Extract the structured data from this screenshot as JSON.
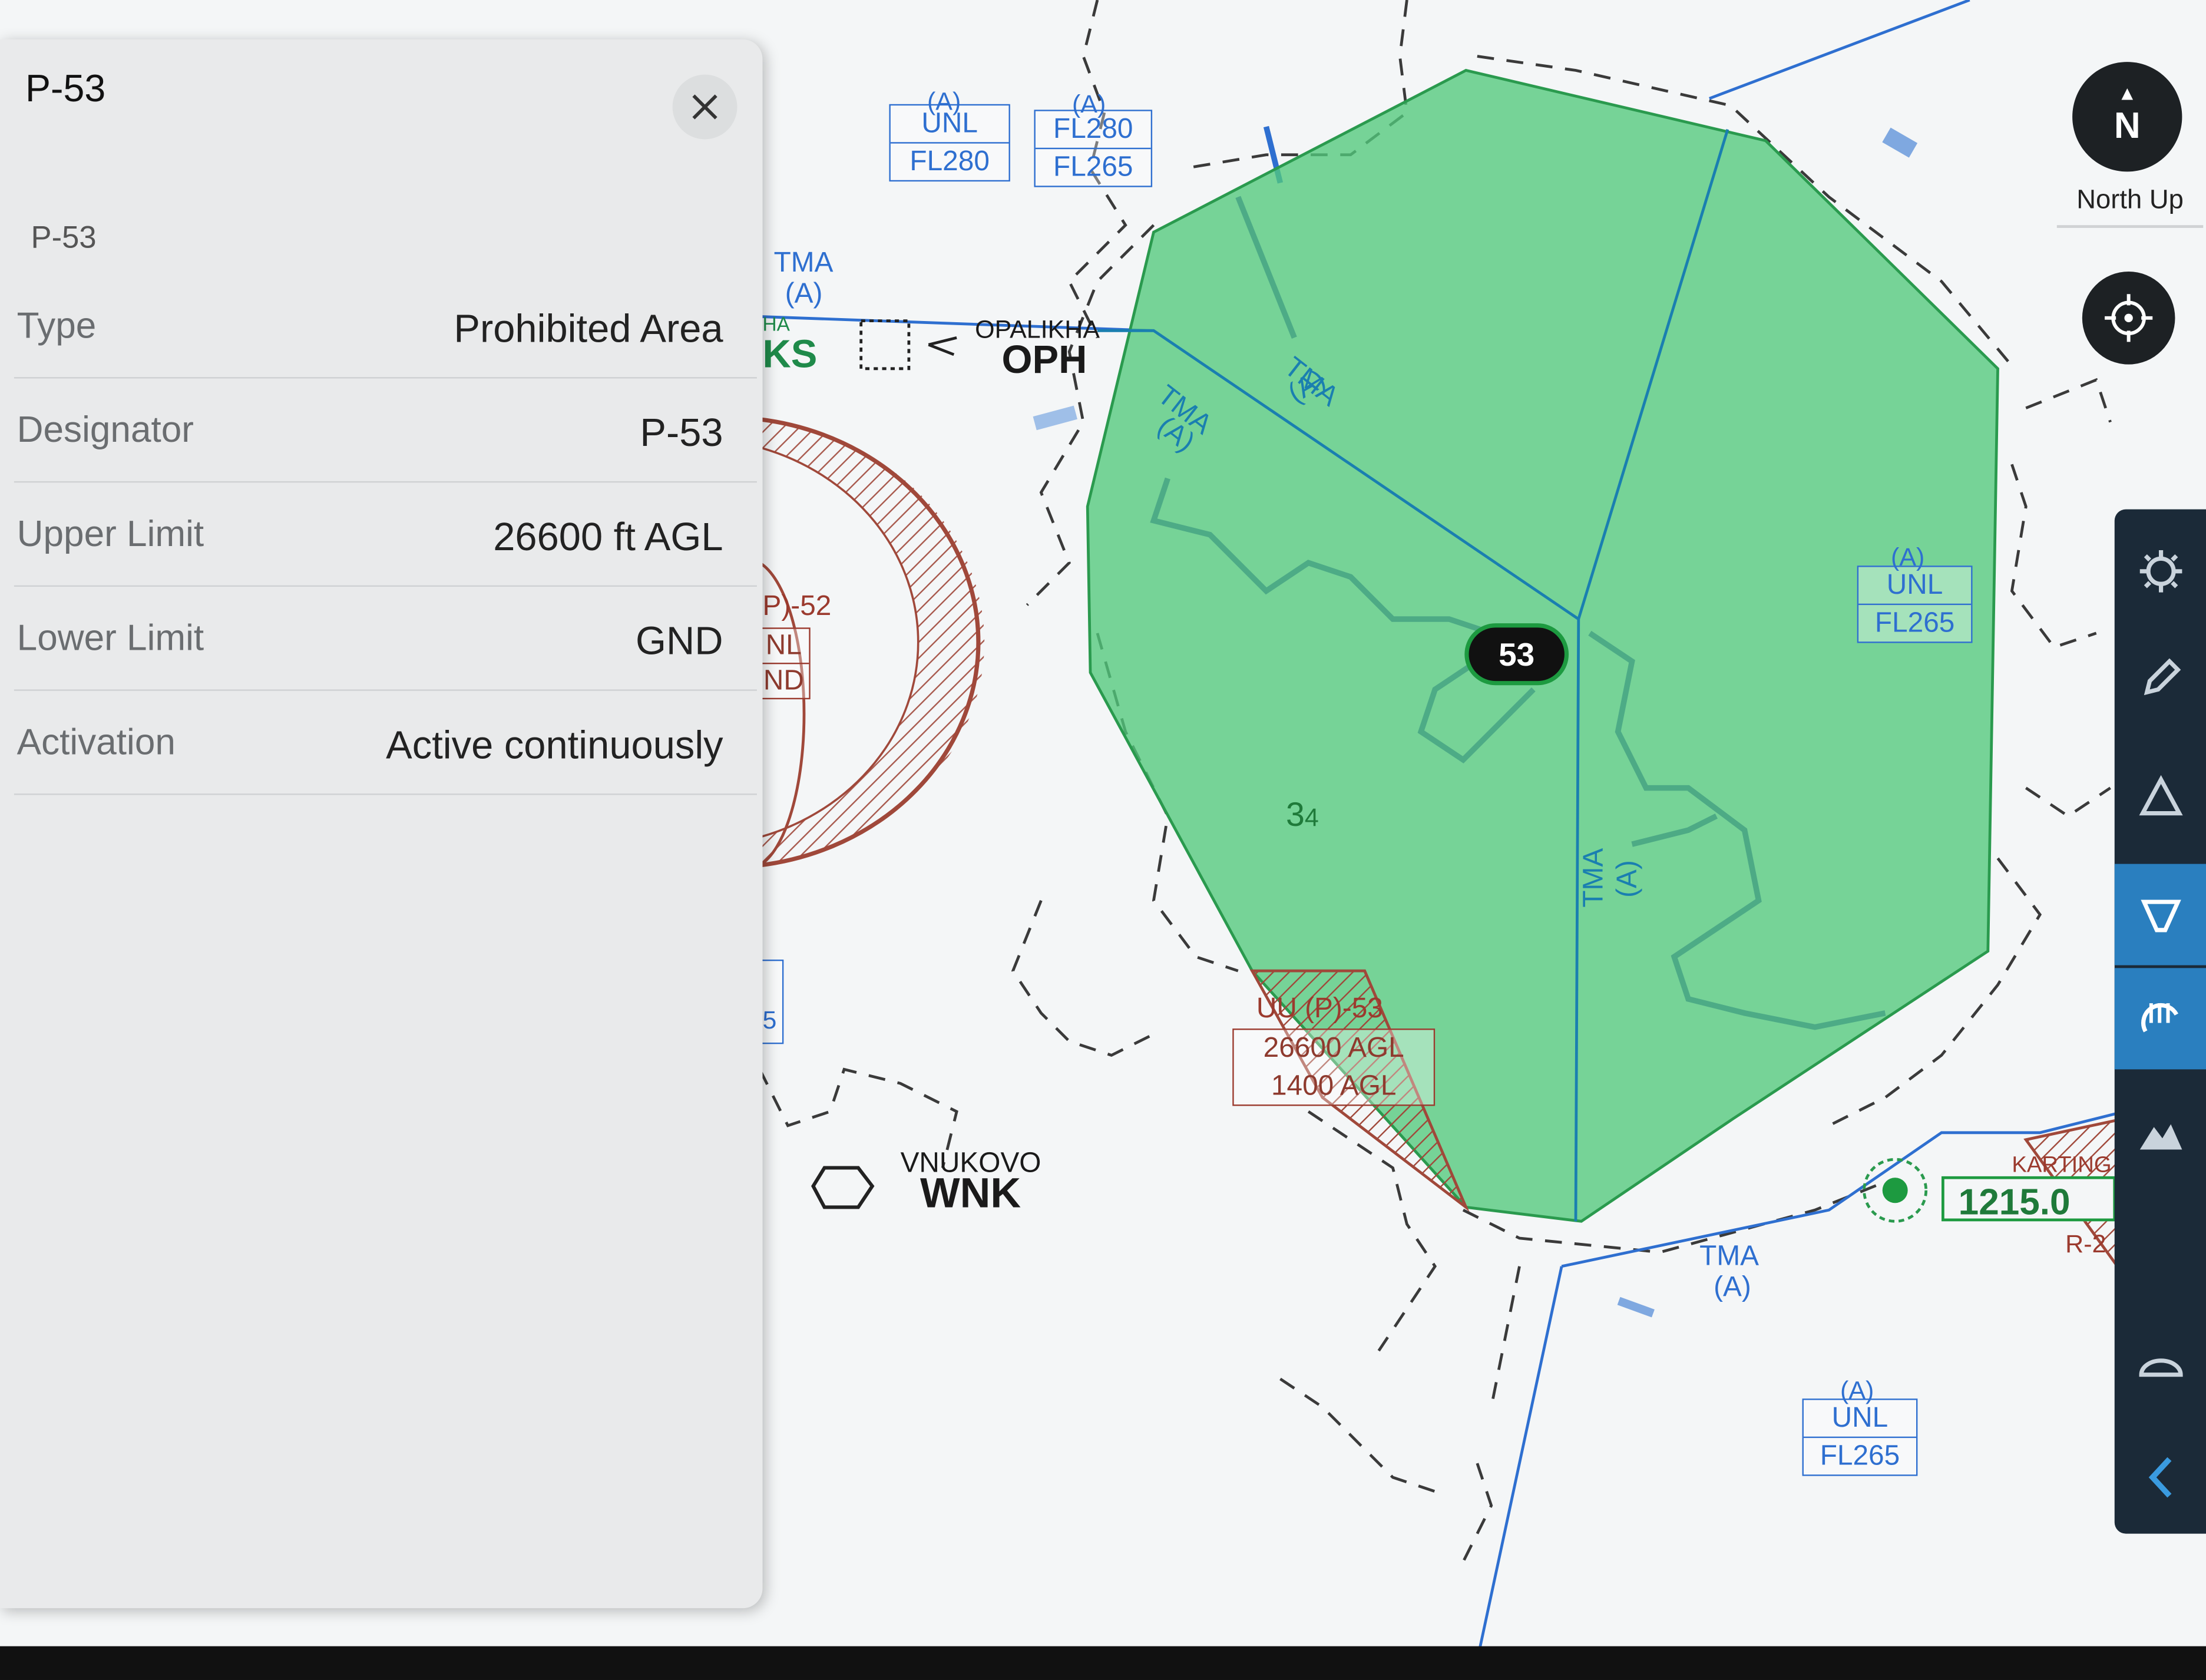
{
  "panel": {
    "title": "P-53",
    "subtitle": "P-53",
    "rows": [
      {
        "key": "Type",
        "value": "Prohibited Area"
      },
      {
        "key": "Designator",
        "value": "P-53"
      },
      {
        "key": "Upper Limit",
        "value": "26600 ft AGL"
      },
      {
        "key": "Lower Limit",
        "value": "GND"
      },
      {
        "key": "Activation",
        "value": "Active continuously"
      }
    ]
  },
  "controls": {
    "north_arrow": "▲",
    "north_letter": "N",
    "north_label": "North Up",
    "icons": [
      "close-icon",
      "locate-icon",
      "settings-icon",
      "edit-icon",
      "triangle-icon",
      "route-icon",
      "airspace-icon",
      "terrain-icon",
      "layers-icon",
      "chevron-left-icon"
    ]
  },
  "map": {
    "box_unl_fl280": {
      "top": "(A)",
      "upper": "UNL",
      "lower": "FL280"
    },
    "box_fl280_fl265": {
      "top": "(A)",
      "upper": "FL280",
      "lower": "FL265"
    },
    "box_right": {
      "top": "(A)",
      "upper": "UNL",
      "lower": "FL265"
    },
    "box_bottom": {
      "top": "(A)",
      "upper": "UNL",
      "lower": "FL265"
    },
    "tma_labels": [
      "TMA\n(A)",
      "TMA\n(A)",
      "TMA\n(A)",
      "TMA\n(A)",
      "TMA\n(A)"
    ],
    "tma_top": "TMA",
    "tma_top_a": "(A)",
    "tma_diag1": "TMA",
    "tma_diag1_a": "(A)",
    "tma_diag2": "TMA",
    "tma_diag2_a": "(A)",
    "tma_vert": "TMA",
    "tma_vert_a": "(A)",
    "tma_bottom": "TMA",
    "tma_bottom_a": "(A)",
    "opalikha_name": "OPALIKHA",
    "opalikha_code": "OPH",
    "ks_code": "KS",
    "ks_prefix": "HA",
    "vnukovo_name": "VNUKOVO",
    "vnukovo_code": "WNK",
    "p52_label": "P)-52",
    "p52_box_upper": "NL",
    "p52_box_lower": "ND",
    "p53_badge": "53",
    "elev_label_big": "3",
    "elev_label_small": "4",
    "p53_box_title": "UU (P)-53",
    "p53_box_upper": "26600 AGL",
    "p53_box_lower": "1400 AGL",
    "left_box_frag": "5",
    "freq": "1215.0",
    "karting": "KARTING",
    "r_label": "R-2"
  },
  "colors": {
    "restricted_green": "#52c97c",
    "airspace_blue": "#2e6fd0",
    "prohibited_red": "#9b3a2e",
    "toolbar_bg": "#1b2a38",
    "accent": "#2a7fbf"
  }
}
